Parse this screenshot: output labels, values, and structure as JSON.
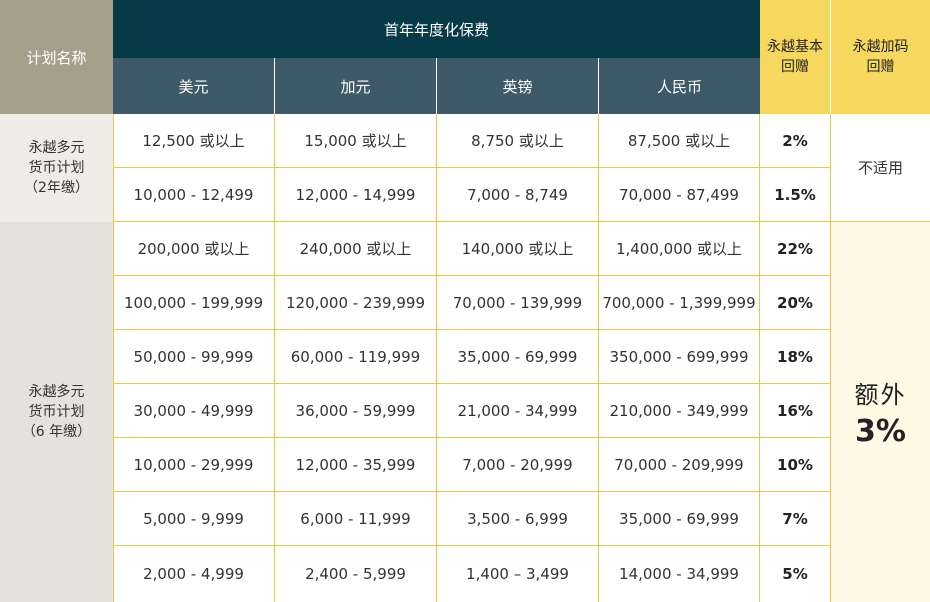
{
  "header": {
    "plan_name": "计划名称",
    "group_title": "首年年度化保费",
    "currencies": [
      "美元",
      "加元",
      "英镑",
      "人民币"
    ],
    "basic_bonus": [
      "永越基本",
      "回赠"
    ],
    "extra_bonus": [
      "永越加码",
      "回赠"
    ]
  },
  "plans": [
    {
      "name_lines": [
        "永越多元",
        "货币计划",
        "（2年缴）"
      ]
    },
    {
      "name_lines": [
        "永越多元",
        "货币计划",
        "（6 年缴）"
      ]
    }
  ],
  "rows": [
    {
      "usd": "12,500 或以上",
      "cad": "15,000 或以上",
      "gbp": "8,750 或以上",
      "rmb": "87,500 或以上",
      "rate": "2%"
    },
    {
      "usd": "10,000 - 12,499",
      "cad": "12,000 - 14,999",
      "gbp": "7,000 - 8,749",
      "rmb": "70,000 - 87,499",
      "rate": "1.5%"
    },
    {
      "usd": "200,000 或以上",
      "cad": "240,000 或以上",
      "gbp": "140,000 或以上",
      "rmb": "1,400,000 或以上",
      "rate": "22%"
    },
    {
      "usd": "100,000 - 199,999",
      "cad": "120,000 - 239,999",
      "gbp": "70,000 - 139,999",
      "rmb": "700,000 - 1,399,999",
      "rate": "20%"
    },
    {
      "usd": "50,000 - 99,999",
      "cad": "60,000 - 119,999",
      "gbp": "35,000 - 69,999",
      "rmb": "350,000 - 699,999",
      "rate": "18%"
    },
    {
      "usd": "30,000 - 49,999",
      "cad": "36,000 - 59,999",
      "gbp": "21,000 - 34,999",
      "rmb": "210,000 - 349,999",
      "rate": "16%"
    },
    {
      "usd": "10,000 - 29,999",
      "cad": "12,000 - 35,999",
      "gbp": "7,000 - 20,999",
      "rmb": "70,000 - 209,999",
      "rate": "10%"
    },
    {
      "usd": "5,000 - 9,999",
      "cad": "6,000 - 11,999",
      "gbp": "3,500 - 6,999",
      "rmb": "35,000 - 69,999",
      "rate": "7%"
    },
    {
      "usd": "2,000 - 4,999",
      "cad": "2,400 - 5,999",
      "gbp": "1,400 – 3,499",
      "rmb": "14,000 - 34,999",
      "rate": "5%"
    }
  ],
  "extra": {
    "plan1": "不适用",
    "plan2_label": "额外",
    "plan2_value": "3%"
  }
}
